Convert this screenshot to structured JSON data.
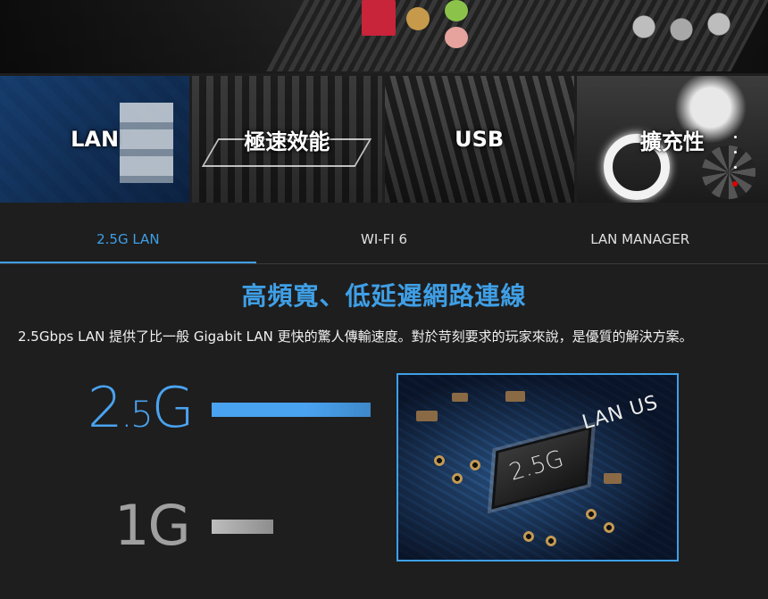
{
  "hero": {
    "icon": "motherboard-io-photo"
  },
  "features": [
    {
      "label": "LAN"
    },
    {
      "label": "極速效能"
    },
    {
      "label": "USB"
    },
    {
      "label": "擴充性"
    }
  ],
  "tabs": [
    {
      "label": "2.5G LAN",
      "active": true
    },
    {
      "label": "WI-FI 6",
      "active": false
    },
    {
      "label": "LAN MANAGER",
      "active": false
    }
  ],
  "section": {
    "headline": "高頻寬、低延遲網路連線",
    "description": "2.5Gbps LAN 提供了比一般 Gigabit LAN 更快的驚人傳輸速度。對於苛刻要求的玩家來說，是優質的解決方案。"
  },
  "comparison": {
    "fast_label_main": "2",
    "fast_label_dot": ".",
    "fast_label_small": "5",
    "fast_label_unit": "G",
    "slow_label": "1G",
    "fast_level": 1.0,
    "slow_level": 0.39,
    "fast_color": "#4aa3f0",
    "slow_color": "#a0a0a0"
  },
  "chip_image": {
    "chip_text": "2.5G",
    "board_text": "LAN US"
  },
  "colors": {
    "accent": "#3f9fe6",
    "background": "#1e1e1e"
  }
}
